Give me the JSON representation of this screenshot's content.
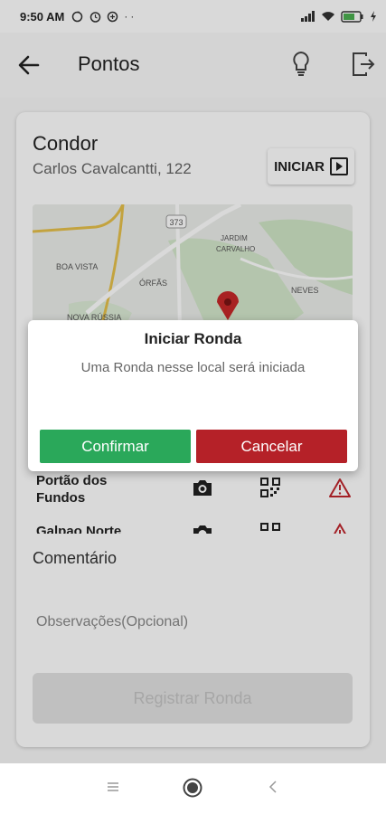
{
  "status_bar": {
    "time": "9:50 AM",
    "icons": [
      "sync-icon",
      "alarm-icon",
      "data-saver-icon",
      "more-icon",
      "signal-icon",
      "wifi-icon",
      "battery-icon",
      "charging-icon"
    ]
  },
  "app_bar": {
    "title": "Pontos"
  },
  "location": {
    "name": "Condor",
    "address": "Carlos Cavalcantti, 122",
    "start_label": "INICIAR"
  },
  "map": {
    "labels": [
      "BOA VISTA",
      "ÓRFÃS",
      "NOVA RÚSSIA",
      "JARDIM CARVALHO",
      "NEVES",
      "373"
    ]
  },
  "points": [
    {
      "label": "Portão dos Fundos"
    },
    {
      "label": "Galpao Norte"
    }
  ],
  "comment": {
    "label": "Comentário",
    "placeholder": "Observações(Opcional)"
  },
  "register_label": "Registrar Ronda",
  "dialog": {
    "title": "Iniciar Ronda",
    "message": "Uma Ronda nesse local será iniciada",
    "confirm_label": "Confirmar",
    "cancel_label": "Cancelar"
  },
  "colors": {
    "confirm": "#2aa85a",
    "cancel": "#b52128",
    "warning": "#c0262d",
    "map_pin": "#c62828"
  }
}
